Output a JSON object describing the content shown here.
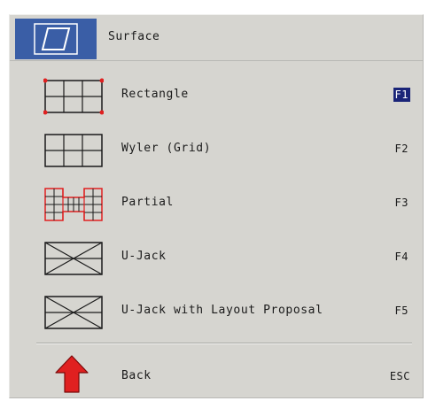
{
  "header": {
    "title": "Surface",
    "icon": "parallelogram-icon",
    "accent_color": "#3a5ea6"
  },
  "menu": {
    "items": [
      {
        "label": "Rectangle",
        "key": "F1",
        "icon": "rectangle-grid-icon",
        "selected": true
      },
      {
        "label": "Wyler (Grid)",
        "key": "F2",
        "icon": "wyler-grid-icon",
        "selected": false
      },
      {
        "label": "Partial",
        "key": "F3",
        "icon": "partial-grid-icon",
        "selected": false
      },
      {
        "label": "U-Jack",
        "key": "F4",
        "icon": "ujack-icon",
        "selected": false
      },
      {
        "label": "U-Jack with Layout Proposal",
        "key": "F5",
        "icon": "ujack-layout-icon",
        "selected": false
      }
    ],
    "selected_key_bg": "#1a2478"
  },
  "back": {
    "label": "Back",
    "key": "ESC",
    "icon": "red-up-arrow-icon",
    "icon_color": "#e02020"
  }
}
